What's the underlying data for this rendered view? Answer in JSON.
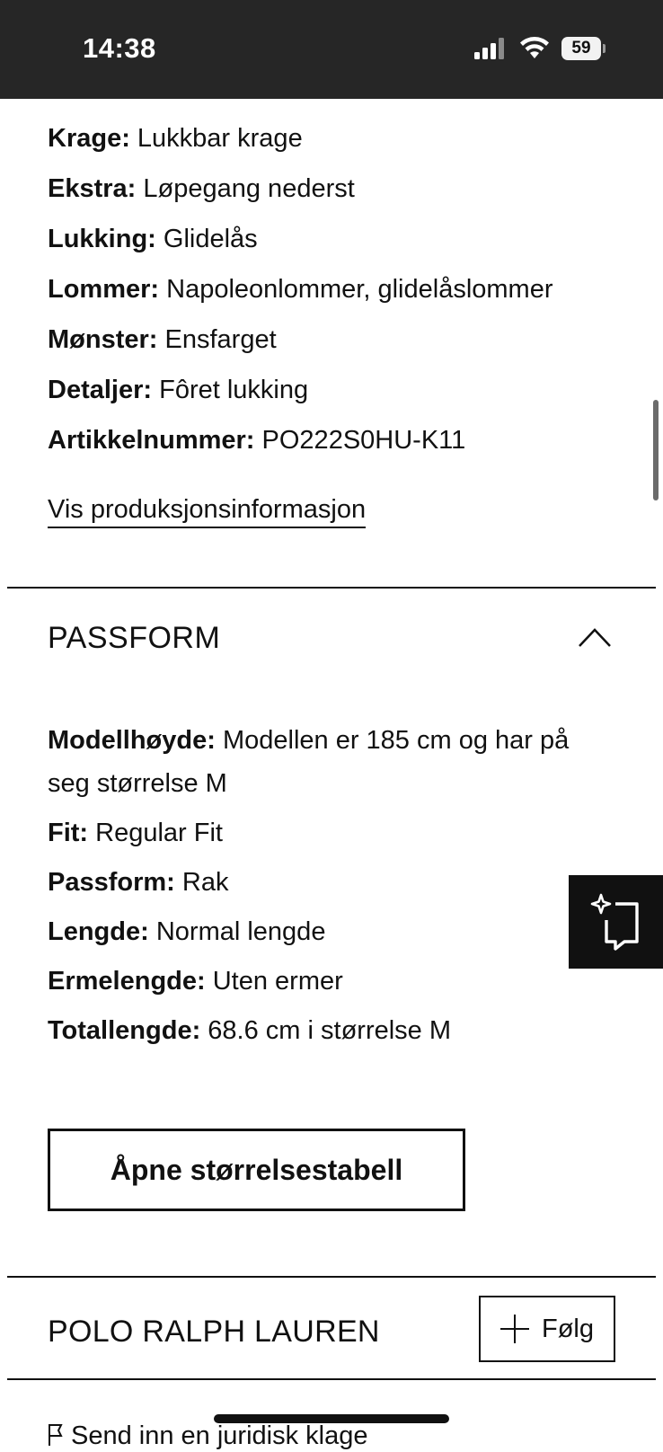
{
  "status_bar": {
    "time": "14:38",
    "battery": "59"
  },
  "specs": [
    {
      "label": "Krage:",
      "value": "Lukkbar krage"
    },
    {
      "label": "Ekstra:",
      "value": "Løpegang nederst"
    },
    {
      "label": "Lukking:",
      "value": "Glidelås"
    },
    {
      "label": "Lommer:",
      "value": "Napoleonlommer, glidelåslommer"
    },
    {
      "label": "Mønster:",
      "value": "Ensfarget"
    },
    {
      "label": "Detaljer:",
      "value": "Fôret lukking"
    },
    {
      "label": "Artikkelnummer:",
      "value": "PO222S0HU-K11"
    }
  ],
  "production_link": "Vis produksjonsinformasjon",
  "passform": {
    "title": "PASSFORM",
    "items": [
      {
        "label": "Modellhøyde:",
        "value": "Modellen er 185 cm og har på seg størrelse M"
      },
      {
        "label": "Fit:",
        "value": "Regular Fit"
      },
      {
        "label": "Passform:",
        "value": "Rak"
      },
      {
        "label": "Lengde:",
        "value": "Normal lengde"
      },
      {
        "label": "Ermelengde:",
        "value": "Uten ermer"
      },
      {
        "label": "Totallengde:",
        "value": "68.6 cm i størrelse M"
      }
    ],
    "size_table_button": "Åpne størrelsestabell"
  },
  "brand": {
    "name": "POLO RALPH LAUREN",
    "follow_label": "Følg"
  },
  "legal_link": "Send inn en juridisk klage",
  "icons": {
    "section_toggle": "chevron-up-icon",
    "floating_button": "sparkle-crop-icon",
    "follow": "plus-icon",
    "legal": "flag-icon"
  }
}
